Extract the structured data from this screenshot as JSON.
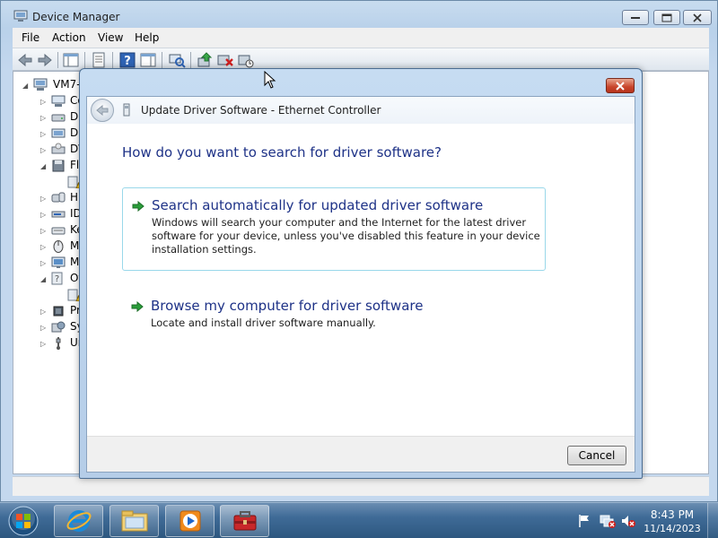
{
  "device_manager": {
    "title": "Device Manager",
    "menu": [
      "File",
      "Action",
      "View",
      "Help"
    ],
    "tree_root": "VM7-",
    "tree_items": [
      {
        "label": "Co",
        "expander": "▷",
        "icon": "computer-icon"
      },
      {
        "label": "Di",
        "expander": "▷",
        "icon": "disk-drive-icon"
      },
      {
        "label": "Di",
        "expander": "▷",
        "icon": "display-adapter-icon"
      },
      {
        "label": "D\\",
        "expander": "▷",
        "icon": "dvd-drive-icon"
      },
      {
        "label": "Fl",
        "expander": "◢",
        "icon": "floppy-controller-icon"
      },
      {
        "label": "",
        "expander": "",
        "icon": "warning-device-icon"
      },
      {
        "label": "Hu",
        "expander": "▷",
        "icon": "hid-icon"
      },
      {
        "label": "ID",
        "expander": "▷",
        "icon": "ide-controller-icon"
      },
      {
        "label": "Ke",
        "expander": "▷",
        "icon": "keyboard-icon"
      },
      {
        "label": "M",
        "expander": "▷",
        "icon": "mouse-icon"
      },
      {
        "label": "M",
        "expander": "▷",
        "icon": "monitor-icon"
      },
      {
        "label": "Ot",
        "expander": "◢",
        "icon": "other-devices-icon"
      },
      {
        "label": "",
        "expander": "",
        "icon": "warning-device-icon"
      },
      {
        "label": "Pr",
        "expander": "▷",
        "icon": "processor-icon"
      },
      {
        "label": "Sy",
        "expander": "▷",
        "icon": "system-devices-icon"
      },
      {
        "label": "Ur",
        "expander": "▷",
        "icon": "usb-controller-icon"
      }
    ]
  },
  "dialog": {
    "title": "Update Driver Software - Ethernet Controller",
    "question": "How do you want to search for driver software?",
    "options": [
      {
        "title": "Search automatically for updated driver software",
        "description": "Windows will search your computer and the Internet for the latest driver software for your device, unless you've disabled this feature in your device installation settings."
      },
      {
        "title": "Browse my computer for driver software",
        "description": "Locate and install driver software manually."
      }
    ],
    "cancel_label": "Cancel"
  },
  "taskbar": {
    "apps": [
      "internet-explorer-icon",
      "windows-explorer-icon",
      "media-player-icon",
      "device-manager-icon"
    ],
    "tray_icons": [
      "action-center-flag-icon",
      "network-error-icon",
      "volume-muted-icon"
    ],
    "time": "8:43 PM",
    "date": "11/14/2023"
  },
  "colors": {
    "heading_blue": "#1e3287",
    "option_border": "#99d8ea",
    "arrow_green": "#2a9d3a",
    "close_red": "#c8442a"
  }
}
